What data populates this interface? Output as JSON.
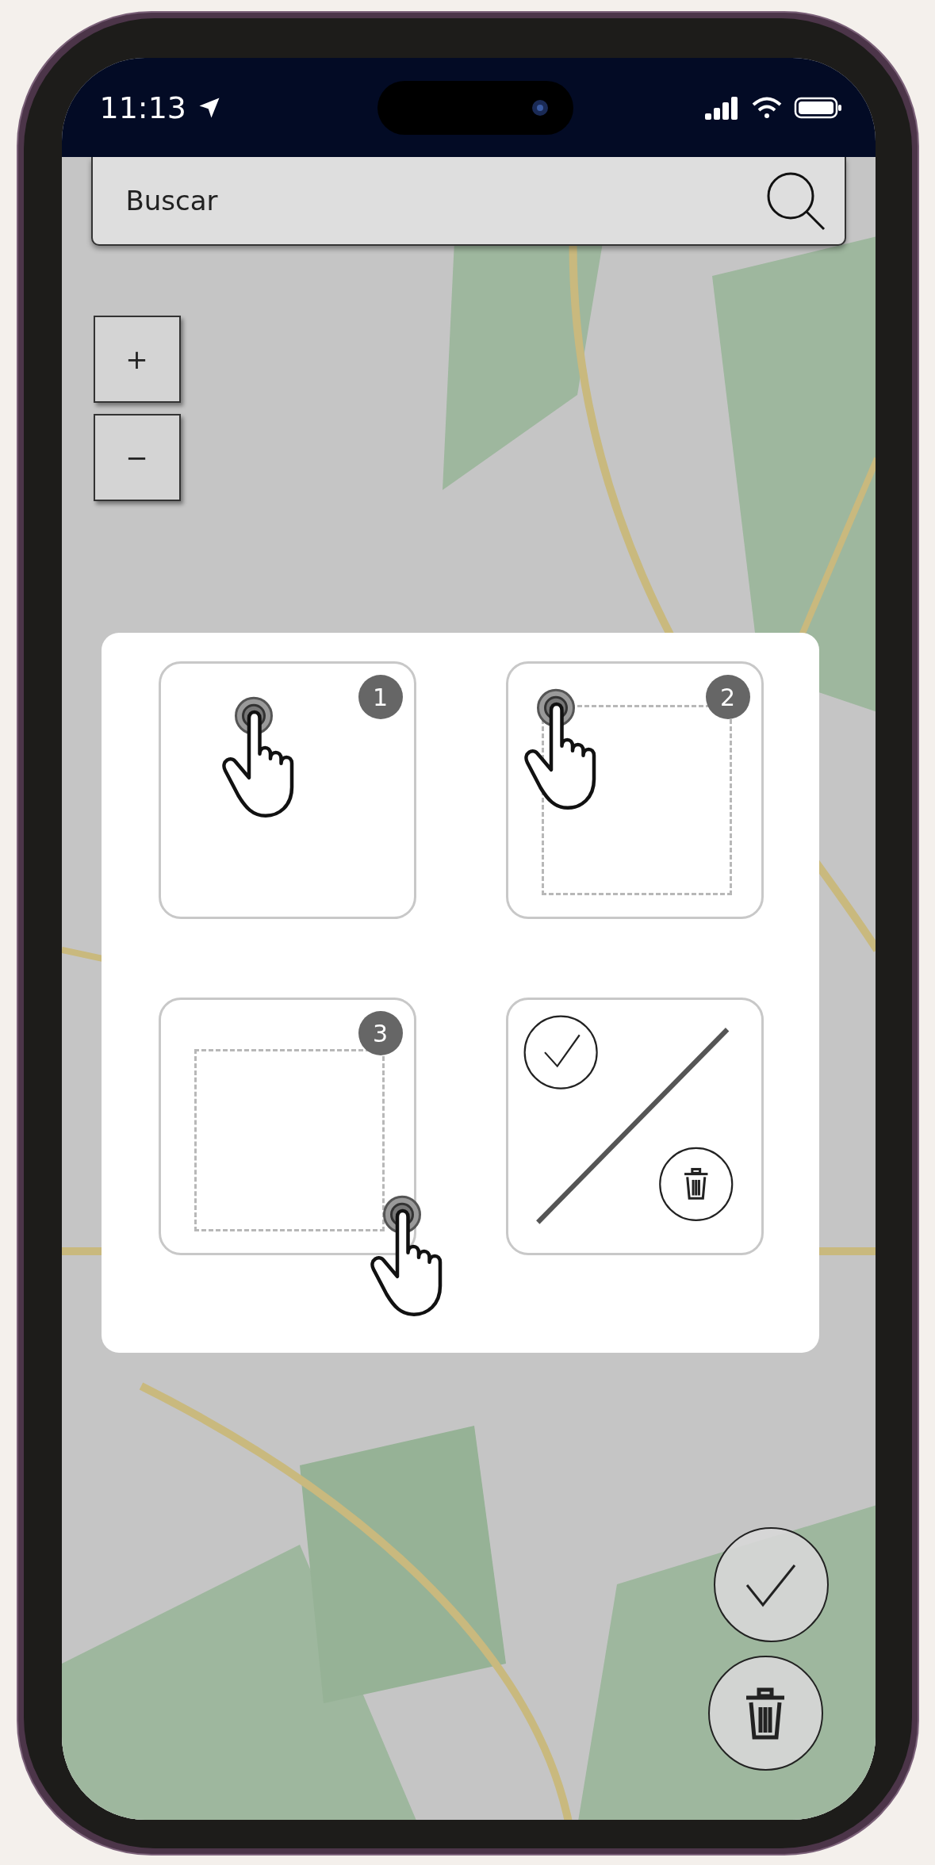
{
  "status_bar": {
    "time": "11:13"
  },
  "search": {
    "placeholder": "Buscar"
  },
  "zoom_controls": [
    {
      "label": "+"
    },
    {
      "label": "−"
    }
  ],
  "tutorial": {
    "steps": [
      {
        "kind": "tap",
        "badge": "1"
      },
      {
        "kind": "tap_box",
        "badge": "2"
      },
      {
        "kind": "drag_box",
        "badge": "3"
      },
      {
        "kind": "confirm_delete"
      }
    ]
  },
  "actions": [
    {
      "kind": "confirm"
    },
    {
      "kind": "delete"
    }
  ]
}
